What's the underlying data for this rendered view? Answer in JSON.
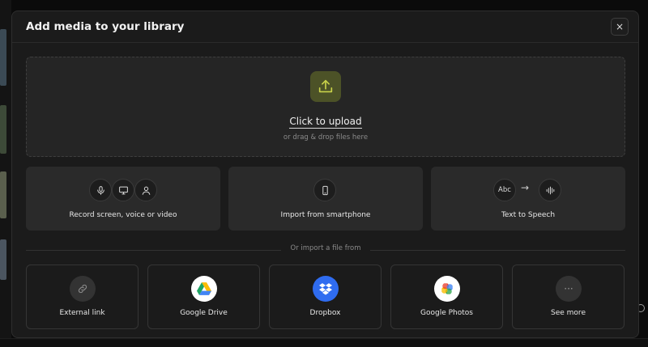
{
  "dialog": {
    "title": "Add media to your library",
    "close_icon": "close-icon",
    "close_glyph": "×"
  },
  "upload": {
    "icon": "upload-icon",
    "title": "Click to upload",
    "subtitle": "or drag & drop files here",
    "accent_color": "#4c5227"
  },
  "options": [
    {
      "label": "Record screen, voice or video",
      "icons": [
        "microphone-icon",
        "monitor-icon",
        "person-icon"
      ]
    },
    {
      "label": "Import from smartphone",
      "icons": [
        "smartphone-icon"
      ]
    },
    {
      "label": "Text to Speech",
      "icons": [
        "abc-icon",
        "arrow-right-icon",
        "soundwave-icon"
      ],
      "abc_text": "Abc",
      "arrow_glyph": "→"
    }
  ],
  "import_divider": "Or import a file from",
  "sources": [
    {
      "label": "External link",
      "icon": "link-icon"
    },
    {
      "label": "Google Drive",
      "icon": "google-drive-icon"
    },
    {
      "label": "Dropbox",
      "icon": "dropbox-icon",
      "color": "#2f6cf0"
    },
    {
      "label": "Google Photos",
      "icon": "google-photos-icon"
    },
    {
      "label": "See more",
      "icon": "more-dots-icon",
      "glyph": "···"
    }
  ]
}
